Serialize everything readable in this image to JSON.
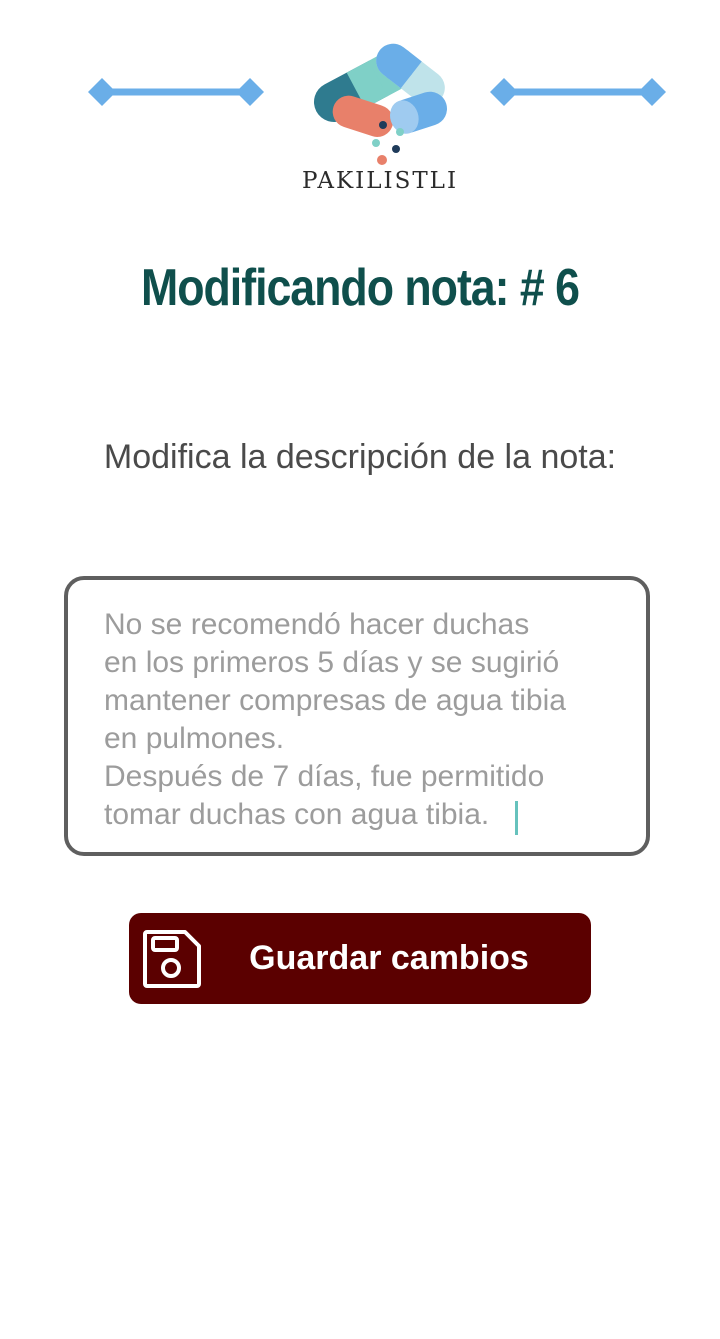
{
  "brand": {
    "name": "PAKILISTLI"
  },
  "page": {
    "title": "Modificando nota: # 6"
  },
  "form": {
    "label": "Modifica la descripción de la nota:",
    "description_value": "No se recomendó hacer duchas\nen los primeros 5 días y se sugirió\nmantener compresas de agua tibia\nen pulmones.\nDespués de 7 días, fue permitido\ntomar duchas con agua tibia."
  },
  "actions": {
    "save_label": "Guardar cambios",
    "save_icon": "floppy-disk-icon"
  },
  "colors": {
    "title": "#0f4f4c",
    "button_bg": "#5b0000",
    "divider": "#6aaee8",
    "text_gray": "#4a4a4a",
    "placeholder_gray": "#9c9c9c",
    "cursor": "#66c2bd"
  }
}
